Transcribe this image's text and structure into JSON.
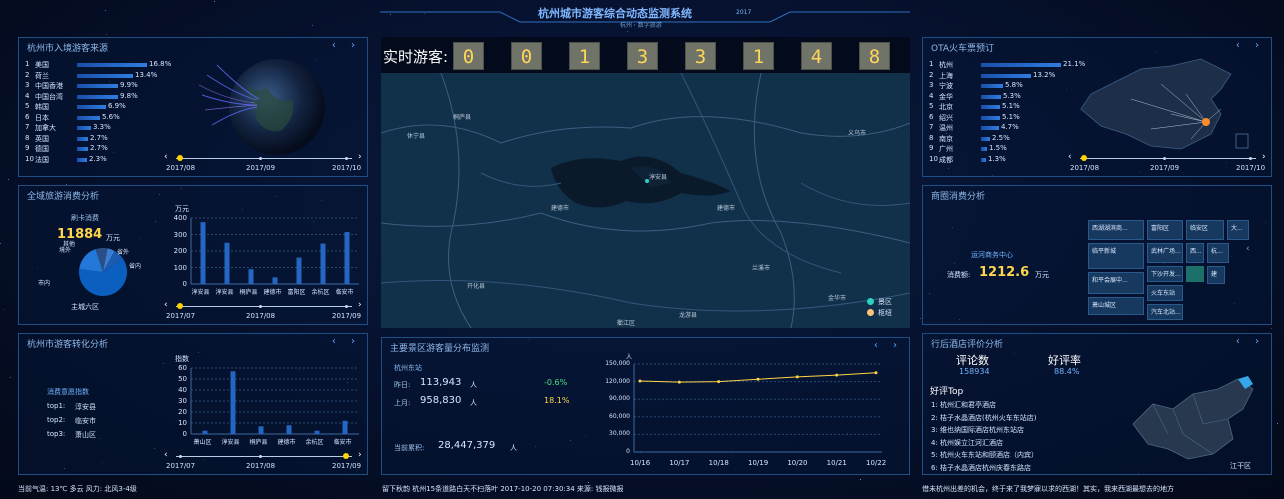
{
  "header": {
    "title": "杭州城市游客综合动态监测系统",
    "year": "2017",
    "subtitle": "杭州 · 数字旅游"
  },
  "source_panel": {
    "title": "杭州市入境游客来源",
    "items": [
      {
        "rank": "1",
        "name": "美国",
        "value": "16.8%",
        "pct": 16.8
      },
      {
        "rank": "2",
        "name": "荷兰",
        "value": "13.4%",
        "pct": 13.4
      },
      {
        "rank": "3",
        "name": "中国香港",
        "value": "9.9%",
        "pct": 9.9
      },
      {
        "rank": "4",
        "name": "中国台湾",
        "value": "9.8%",
        "pct": 9.8
      },
      {
        "rank": "5",
        "name": "韩国",
        "value": "6.9%",
        "pct": 6.9
      },
      {
        "rank": "6",
        "name": "日本",
        "value": "5.6%",
        "pct": 5.6
      },
      {
        "rank": "7",
        "name": "加拿大",
        "value": "3.3%",
        "pct": 3.3
      },
      {
        "rank": "8",
        "name": "英国",
        "value": "2.7%",
        "pct": 2.7
      },
      {
        "rank": "9",
        "name": "德国",
        "value": "2.7%",
        "pct": 2.7
      },
      {
        "rank": "10",
        "name": "法国",
        "value": "2.3%",
        "pct": 2.3
      }
    ],
    "timeline": [
      "2017/08",
      "2017/09",
      "2017/10"
    ]
  },
  "consume_panel": {
    "title": "全域旅游消费分析",
    "card_label": "刷卡消费",
    "card_value": "11884",
    "card_unit": "万元",
    "pie_labels": [
      "其他",
      "境外",
      "省外",
      "省内",
      "市内"
    ],
    "pie_center": "主城六区",
    "bar_unit": "万元",
    "timeline": [
      "2017/07",
      "2017/08",
      "2017/09"
    ]
  },
  "convert_panel": {
    "title": "杭州市游客转化分析",
    "unit": "指数",
    "intent_title": "消费意愿指数",
    "tops": [
      {
        "label": "top1:",
        "name": "淳安县"
      },
      {
        "label": "top2:",
        "name": "临安市"
      },
      {
        "label": "top3:",
        "name": "萧山区"
      }
    ],
    "timeline": [
      "2017/07",
      "2017/08",
      "2017/09"
    ]
  },
  "realtime": {
    "label": "实时游客:",
    "digits": [
      "0",
      "0",
      "1",
      "3",
      "3",
      "1",
      "4",
      "8"
    ]
  },
  "map": {
    "places": [
      "建德市",
      "淳安县",
      "建德市",
      "兰溪市",
      "龙游县",
      "金华市",
      "义乌市",
      "开化县",
      "休宁县",
      "桐庐县",
      "衢江区"
    ],
    "legend": [
      "景区",
      "枢纽"
    ]
  },
  "scenic_panel": {
    "title": "主要景区游客量分布监测",
    "station": "杭州东站",
    "yesterday_label": "昨日:",
    "yesterday_value": "113,943",
    "yesterday_unit": "人",
    "yesterday_change": "-0.6%",
    "lastmonth_label": "上月:",
    "lastmonth_value": "958,830",
    "lastmonth_unit": "人",
    "lastmonth_change": "18.1%",
    "total_label": "当前累积:",
    "total_value": "28,447,379",
    "total_unit": "人",
    "chart_ylabel": "人"
  },
  "ota_panel": {
    "title": "OTA火车票预订",
    "items": [
      {
        "rank": "1",
        "name": "杭州",
        "value": "21.1%",
        "pct": 21.1
      },
      {
        "rank": "2",
        "name": "上海",
        "value": "13.2%",
        "pct": 13.2
      },
      {
        "rank": "3",
        "name": "宁波",
        "value": "5.8%",
        "pct": 5.8
      },
      {
        "rank": "4",
        "name": "金华",
        "value": "5.3%",
        "pct": 5.3
      },
      {
        "rank": "5",
        "name": "北京",
        "value": "5.1%",
        "pct": 5.1
      },
      {
        "rank": "6",
        "name": "绍兴",
        "value": "5.1%",
        "pct": 5.1
      },
      {
        "rank": "7",
        "name": "温州",
        "value": "4.7%",
        "pct": 4.7
      },
      {
        "rank": "8",
        "name": "南京",
        "value": "2.5%",
        "pct": 2.5
      },
      {
        "rank": "9",
        "name": "广州",
        "value": "1.5%",
        "pct": 1.5
      },
      {
        "rank": "10",
        "name": "成都",
        "value": "1.3%",
        "pct": 1.3
      }
    ],
    "timeline": [
      "2017/08",
      "2017/09",
      "2017/10"
    ]
  },
  "business_panel": {
    "title": "商圈消费分析",
    "center": "运河商务中心",
    "amount_label": "消费额:",
    "amount_value": "1212.6",
    "amount_unit": "万元",
    "tiles": [
      "西湖湖滨商...",
      "富阳区",
      "临安区",
      "大...",
      "临平新城",
      "武林广场...",
      "西...",
      "杭...",
      "下沙开发...",
      "和平会展中...",
      "火车东站",
      "建",
      "萧山城区",
      "汽车北站..."
    ]
  },
  "hotel_panel": {
    "title": "行后酒店评价分析",
    "reviews_label": "评论数",
    "reviews_value": "158934",
    "rate_label": "好评率",
    "rate_value": "88.4%",
    "top_title": "好评Top",
    "tops": [
      "1: 杭州汇和君亭酒店",
      "2: 桔子水晶酒店(杭州火车东站店)",
      "3: 维也纳国际酒店杭州东站店",
      "4: 杭州娱立江河汇酒店",
      "5: 杭州火车东站和颐酒店（内宾）",
      "6: 桔子水晶酒店杭州庆春东路店"
    ],
    "district": "江干区"
  },
  "footer": {
    "weather": "当前气温: 13℃ 多云 风力: 北风3-4级",
    "news": "留下秋韵 杭州15条道路白天不扫落叶 2017-10-20 07:30:34  来源: 钱报微报",
    "scroll": "借未杭州出差的机会，终于来了我梦寐以求的西湖！其实，我来西湖最想去的地方"
  },
  "chart_data": [
    {
      "type": "bar",
      "title": "",
      "categories": [
        "淳安县",
        "淳安县",
        "桐庐县",
        "建德市",
        "富阳区",
        "余杭区",
        "临安市"
      ],
      "values": [
        375,
        250,
        90,
        40,
        160,
        245,
        315
      ],
      "ylabel": "万元",
      "ylim": [
        0,
        400
      ],
      "yticks": [
        0,
        100,
        200,
        300,
        400
      ]
    },
    {
      "type": "bar",
      "title": "",
      "categories": [
        "萧山区",
        "淳安县",
        "桐庐县",
        "建德市",
        "余杭区",
        "临安市"
      ],
      "values": [
        3,
        57,
        7,
        8,
        3,
        12
      ],
      "ylabel": "指数",
      "ylim": [
        0,
        60
      ],
      "yticks": [
        0,
        10,
        20,
        30,
        40,
        50,
        60
      ]
    },
    {
      "type": "line",
      "title": "",
      "x": [
        "10/16",
        "10/17",
        "10/18",
        "10/19",
        "10/20",
        "10/21",
        "10/22"
      ],
      "values": [
        121000,
        119000,
        120000,
        124000,
        128000,
        131000,
        135000
      ],
      "ylabel": "人",
      "ylim": [
        0,
        150000
      ],
      "yticks": [
        "0",
        "30,000",
        "60,000",
        "90,000",
        "120,000",
        "150,000"
      ],
      "line_color": "#ffd54a"
    },
    {
      "type": "pie",
      "title": "",
      "categories": [
        "省内",
        "市内",
        "其他",
        "境外",
        "省外"
      ],
      "values": [
        62,
        18,
        8,
        5,
        7
      ]
    }
  ]
}
